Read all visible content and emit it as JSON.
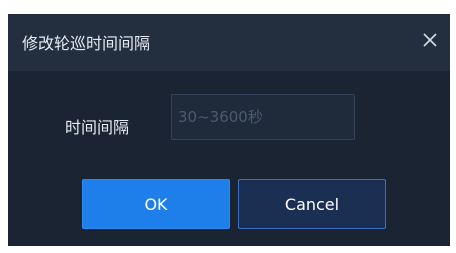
{
  "dialog": {
    "title": "修改轮巡时间间隔",
    "close_icon": "close-icon"
  },
  "form": {
    "interval_label": "时间间隔",
    "interval_value": "",
    "interval_placeholder": "30~3600秒"
  },
  "buttons": {
    "ok_label": "OK",
    "cancel_label": "Cancel"
  },
  "colors": {
    "dialog_bg": "#1a2433",
    "titlebar_bg": "#232e3e",
    "primary": "#1f7fea",
    "secondary_bg": "#1b2f52",
    "secondary_border": "#3c6ec2"
  }
}
